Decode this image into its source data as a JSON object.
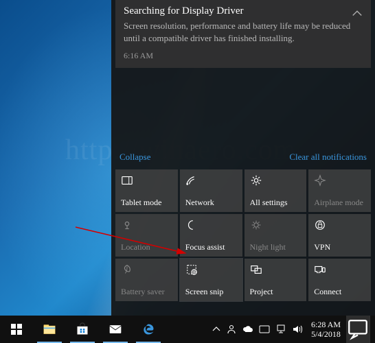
{
  "notification": {
    "title": "Searching for Display Driver",
    "body": "Screen resolution, performance and battery life may be reduced until a compatible driver has finished installing.",
    "time": "6:16 AM"
  },
  "links": {
    "collapse": "Collapse",
    "clear": "Clear all notifications"
  },
  "tiles": [
    {
      "label": "Tablet mode",
      "icon": "tablet",
      "muted": false
    },
    {
      "label": "Network",
      "icon": "network",
      "muted": false
    },
    {
      "label": "All settings",
      "icon": "gear",
      "muted": false
    },
    {
      "label": "Airplane mode",
      "icon": "airplane",
      "muted": true
    },
    {
      "label": "Location",
      "icon": "location",
      "muted": true
    },
    {
      "label": "Focus assist",
      "icon": "moon",
      "muted": false
    },
    {
      "label": "Night light",
      "icon": "sun",
      "muted": true
    },
    {
      "label": "VPN",
      "icon": "vpn",
      "muted": false
    },
    {
      "label": "Battery saver",
      "icon": "leaf",
      "muted": true
    },
    {
      "label": "Screen snip",
      "icon": "snip",
      "muted": false,
      "highlighted": true
    },
    {
      "label": "Project",
      "icon": "project",
      "muted": false
    },
    {
      "label": "Connect",
      "icon": "connect",
      "muted": false
    }
  ],
  "clock": {
    "time": "6:28 AM",
    "date": "5/4/2018"
  },
  "watermark": "http://winaero.com"
}
